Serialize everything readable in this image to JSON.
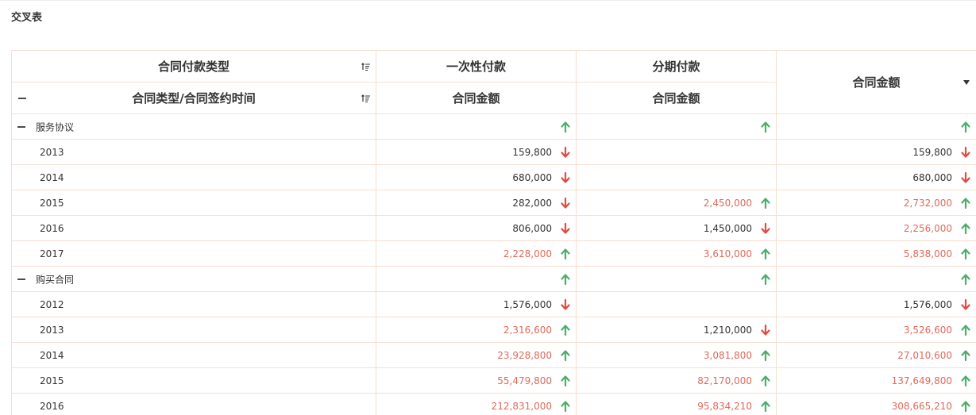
{
  "title": "交叉表",
  "colors": {
    "up": "#4cae6b",
    "down": "#e04a3f",
    "highlight": "#e0695a",
    "border": "#f7dfd2"
  },
  "header": {
    "row1_label": "合同付款类型",
    "row2_label": "合同类型/合同签约时间",
    "col1": "一次性付款",
    "col2": "分期付款",
    "total": "合同金额",
    "measure1": "合同金额",
    "measure2": "合同金额"
  },
  "groups": [
    {
      "name": "服务协议",
      "trend": [
        "up",
        "up",
        "up"
      ],
      "rows": [
        {
          "year": "2013",
          "c1": "159,800",
          "c1_red": false,
          "c1_t": "down",
          "c2": "",
          "c2_red": false,
          "c2_t": "",
          "c3": "159,800",
          "c3_red": false,
          "c3_t": "down"
        },
        {
          "year": "2014",
          "c1": "680,000",
          "c1_red": false,
          "c1_t": "down",
          "c2": "",
          "c2_red": false,
          "c2_t": "",
          "c3": "680,000",
          "c3_red": false,
          "c3_t": "down"
        },
        {
          "year": "2015",
          "c1": "282,000",
          "c1_red": false,
          "c1_t": "down",
          "c2": "2,450,000",
          "c2_red": true,
          "c2_t": "up",
          "c3": "2,732,000",
          "c3_red": true,
          "c3_t": "up"
        },
        {
          "year": "2016",
          "c1": "806,000",
          "c1_red": false,
          "c1_t": "down",
          "c2": "1,450,000",
          "c2_red": false,
          "c2_t": "down",
          "c3": "2,256,000",
          "c3_red": true,
          "c3_t": "up"
        },
        {
          "year": "2017",
          "c1": "2,228,000",
          "c1_red": true,
          "c1_t": "up",
          "c2": "3,610,000",
          "c2_red": true,
          "c2_t": "up",
          "c3": "5,838,000",
          "c3_red": true,
          "c3_t": "up"
        }
      ]
    },
    {
      "name": "购买合同",
      "trend": [
        "up",
        "up",
        "up"
      ],
      "rows": [
        {
          "year": "2012",
          "c1": "1,576,000",
          "c1_red": false,
          "c1_t": "down",
          "c2": "",
          "c2_red": false,
          "c2_t": "",
          "c3": "1,576,000",
          "c3_red": false,
          "c3_t": "down"
        },
        {
          "year": "2013",
          "c1": "2,316,600",
          "c1_red": true,
          "c1_t": "up",
          "c2": "1,210,000",
          "c2_red": false,
          "c2_t": "down",
          "c3": "3,526,600",
          "c3_red": true,
          "c3_t": "up"
        },
        {
          "year": "2014",
          "c1": "23,928,800",
          "c1_red": true,
          "c1_t": "up",
          "c2": "3,081,800",
          "c2_red": true,
          "c2_t": "up",
          "c3": "27,010,600",
          "c3_red": true,
          "c3_t": "up"
        },
        {
          "year": "2015",
          "c1": "55,479,800",
          "c1_red": true,
          "c1_t": "up",
          "c2": "82,170,000",
          "c2_red": true,
          "c2_t": "up",
          "c3": "137,649,800",
          "c3_red": true,
          "c3_t": "up"
        },
        {
          "year": "2016",
          "c1": "212,831,000",
          "c1_red": true,
          "c1_t": "up",
          "c2": "95,834,210",
          "c2_red": true,
          "c2_t": "up",
          "c3": "308,665,210",
          "c3_red": true,
          "c3_t": "up"
        }
      ]
    }
  ]
}
